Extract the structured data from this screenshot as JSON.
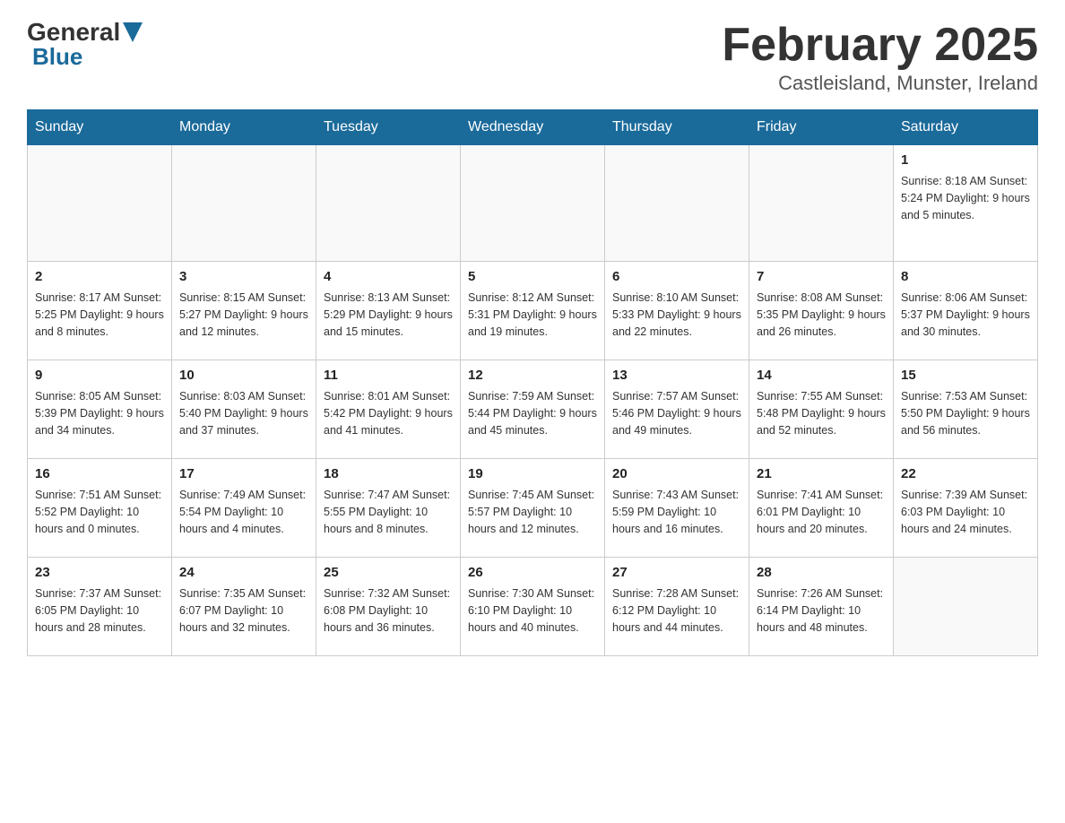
{
  "header": {
    "logo_general": "General",
    "logo_blue": "Blue",
    "month_title": "February 2025",
    "location": "Castleisland, Munster, Ireland"
  },
  "days_of_week": [
    "Sunday",
    "Monday",
    "Tuesday",
    "Wednesday",
    "Thursday",
    "Friday",
    "Saturday"
  ],
  "weeks": [
    {
      "days": [
        {
          "num": "",
          "info": ""
        },
        {
          "num": "",
          "info": ""
        },
        {
          "num": "",
          "info": ""
        },
        {
          "num": "",
          "info": ""
        },
        {
          "num": "",
          "info": ""
        },
        {
          "num": "",
          "info": ""
        },
        {
          "num": "1",
          "info": "Sunrise: 8:18 AM\nSunset: 5:24 PM\nDaylight: 9 hours and 5 minutes."
        }
      ]
    },
    {
      "days": [
        {
          "num": "2",
          "info": "Sunrise: 8:17 AM\nSunset: 5:25 PM\nDaylight: 9 hours and 8 minutes."
        },
        {
          "num": "3",
          "info": "Sunrise: 8:15 AM\nSunset: 5:27 PM\nDaylight: 9 hours and 12 minutes."
        },
        {
          "num": "4",
          "info": "Sunrise: 8:13 AM\nSunset: 5:29 PM\nDaylight: 9 hours and 15 minutes."
        },
        {
          "num": "5",
          "info": "Sunrise: 8:12 AM\nSunset: 5:31 PM\nDaylight: 9 hours and 19 minutes."
        },
        {
          "num": "6",
          "info": "Sunrise: 8:10 AM\nSunset: 5:33 PM\nDaylight: 9 hours and 22 minutes."
        },
        {
          "num": "7",
          "info": "Sunrise: 8:08 AM\nSunset: 5:35 PM\nDaylight: 9 hours and 26 minutes."
        },
        {
          "num": "8",
          "info": "Sunrise: 8:06 AM\nSunset: 5:37 PM\nDaylight: 9 hours and 30 minutes."
        }
      ]
    },
    {
      "days": [
        {
          "num": "9",
          "info": "Sunrise: 8:05 AM\nSunset: 5:39 PM\nDaylight: 9 hours and 34 minutes."
        },
        {
          "num": "10",
          "info": "Sunrise: 8:03 AM\nSunset: 5:40 PM\nDaylight: 9 hours and 37 minutes."
        },
        {
          "num": "11",
          "info": "Sunrise: 8:01 AM\nSunset: 5:42 PM\nDaylight: 9 hours and 41 minutes."
        },
        {
          "num": "12",
          "info": "Sunrise: 7:59 AM\nSunset: 5:44 PM\nDaylight: 9 hours and 45 minutes."
        },
        {
          "num": "13",
          "info": "Sunrise: 7:57 AM\nSunset: 5:46 PM\nDaylight: 9 hours and 49 minutes."
        },
        {
          "num": "14",
          "info": "Sunrise: 7:55 AM\nSunset: 5:48 PM\nDaylight: 9 hours and 52 minutes."
        },
        {
          "num": "15",
          "info": "Sunrise: 7:53 AM\nSunset: 5:50 PM\nDaylight: 9 hours and 56 minutes."
        }
      ]
    },
    {
      "days": [
        {
          "num": "16",
          "info": "Sunrise: 7:51 AM\nSunset: 5:52 PM\nDaylight: 10 hours and 0 minutes."
        },
        {
          "num": "17",
          "info": "Sunrise: 7:49 AM\nSunset: 5:54 PM\nDaylight: 10 hours and 4 minutes."
        },
        {
          "num": "18",
          "info": "Sunrise: 7:47 AM\nSunset: 5:55 PM\nDaylight: 10 hours and 8 minutes."
        },
        {
          "num": "19",
          "info": "Sunrise: 7:45 AM\nSunset: 5:57 PM\nDaylight: 10 hours and 12 minutes."
        },
        {
          "num": "20",
          "info": "Sunrise: 7:43 AM\nSunset: 5:59 PM\nDaylight: 10 hours and 16 minutes."
        },
        {
          "num": "21",
          "info": "Sunrise: 7:41 AM\nSunset: 6:01 PM\nDaylight: 10 hours and 20 minutes."
        },
        {
          "num": "22",
          "info": "Sunrise: 7:39 AM\nSunset: 6:03 PM\nDaylight: 10 hours and 24 minutes."
        }
      ]
    },
    {
      "days": [
        {
          "num": "23",
          "info": "Sunrise: 7:37 AM\nSunset: 6:05 PM\nDaylight: 10 hours and 28 minutes."
        },
        {
          "num": "24",
          "info": "Sunrise: 7:35 AM\nSunset: 6:07 PM\nDaylight: 10 hours and 32 minutes."
        },
        {
          "num": "25",
          "info": "Sunrise: 7:32 AM\nSunset: 6:08 PM\nDaylight: 10 hours and 36 minutes."
        },
        {
          "num": "26",
          "info": "Sunrise: 7:30 AM\nSunset: 6:10 PM\nDaylight: 10 hours and 40 minutes."
        },
        {
          "num": "27",
          "info": "Sunrise: 7:28 AM\nSunset: 6:12 PM\nDaylight: 10 hours and 44 minutes."
        },
        {
          "num": "28",
          "info": "Sunrise: 7:26 AM\nSunset: 6:14 PM\nDaylight: 10 hours and 48 minutes."
        },
        {
          "num": "",
          "info": ""
        }
      ]
    }
  ]
}
